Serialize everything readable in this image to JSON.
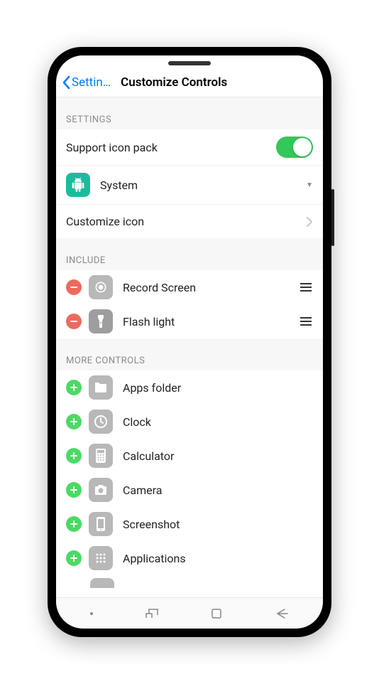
{
  "nav": {
    "back_label": "Settin…",
    "title": "Customize Controls"
  },
  "sections": {
    "settings": {
      "header": "SETTINGS",
      "support_icon_pack": "Support icon pack",
      "support_icon_pack_on": true,
      "system_label": "System",
      "customize_icon": "Customize icon"
    },
    "include": {
      "header": "INCLUDE",
      "items": [
        {
          "label": "Record Screen",
          "icon": "record-icon"
        },
        {
          "label": "Flash light",
          "icon": "flashlight-icon"
        }
      ]
    },
    "more": {
      "header": "MORE CONTROLS",
      "items": [
        {
          "label": "Apps folder",
          "icon": "folder-icon"
        },
        {
          "label": "Clock",
          "icon": "clock-icon"
        },
        {
          "label": "Calculator",
          "icon": "calculator-icon"
        },
        {
          "label": "Camera",
          "icon": "camera-icon"
        },
        {
          "label": "Screenshot",
          "icon": "screenshot-icon"
        },
        {
          "label": "Applications",
          "icon": "applications-icon"
        }
      ]
    }
  },
  "colors": {
    "accent_blue": "#007aff",
    "toggle_green": "#34c759",
    "add_green": "#4cd964",
    "remove_red": "#ed6a5e",
    "icon_gray": "#b8b8b8"
  }
}
